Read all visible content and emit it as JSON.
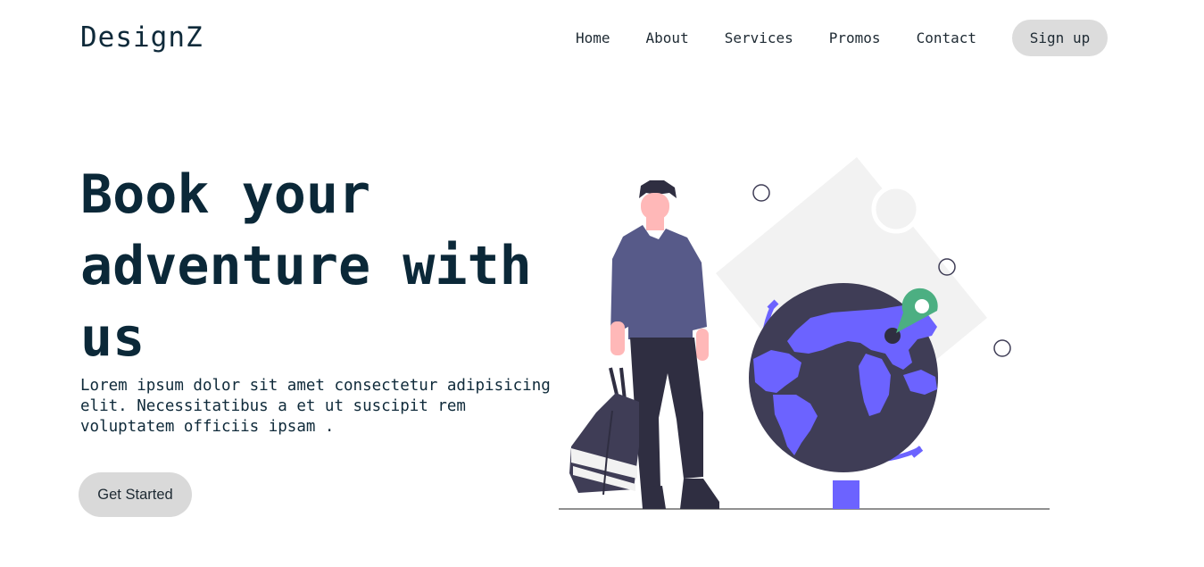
{
  "brand": {
    "logo": "DesignZ"
  },
  "nav": {
    "links": [
      "Home",
      "About",
      "Services",
      "Promos",
      "Contact"
    ],
    "signup": "Sign up"
  },
  "hero": {
    "title": "Book your adventure with us",
    "text": "Lorem ipsum dolor sit amet consectetur adipisicing elit. Necessitatibus a et ut suscipit rem voluptatem officiis ipsam .",
    "cta": "Get Started"
  },
  "colors": {
    "accent": "#6c63ff",
    "pin": "#4caf82",
    "globe": "#3f3d56",
    "shirt": "#575a89",
    "pants": "#2f2e41",
    "skin": "#ffb8b8",
    "button": "#dcdcdc"
  }
}
